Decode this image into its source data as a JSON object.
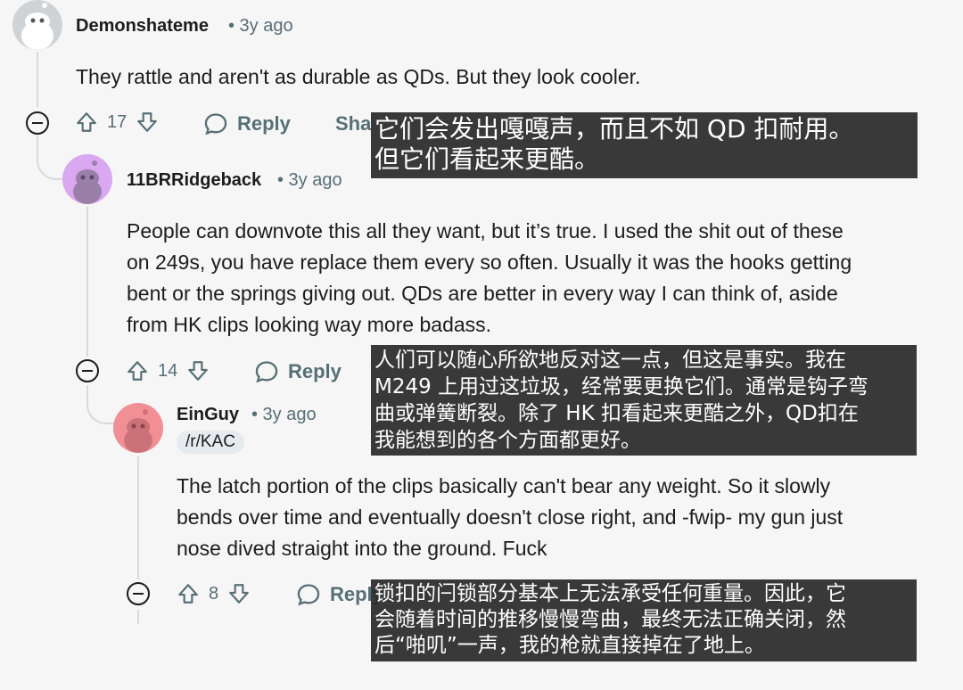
{
  "comments": [
    {
      "username": "Demonshateme",
      "age": "• 3y ago",
      "text": "They rattle and aren't as durable as QDs. But they look cooler.",
      "score": "17",
      "reply_label": "Reply",
      "share_label": "Share"
    },
    {
      "username": "11BRRidgeback",
      "age": "• 3y ago",
      "lines": [
        "People can downvote this all they want, but it’s true. I used the shit out of these",
        "on 249s, you have replace them every so often. Usually it was the hooks getting",
        "bent or the springs giving out. QDs are better in every way I can think of, aside",
        "from HK clips looking way more badass."
      ],
      "score": "14",
      "reply_label": "Reply"
    },
    {
      "username": "EinGuy",
      "age": "• 3y ago",
      "flair": "/r/KAC",
      "lines": [
        "The latch portion of the clips basically can't bear any weight. So it slowly",
        "bends over time and eventually doesn't close right, and -fwip- my gun just",
        "nose dived straight into the ground. Fuck"
      ],
      "score": "8",
      "reply_label": "Reply"
    }
  ],
  "translations": [
    [
      "它们会发出嘎嘎声，而且不如 QD 扣耐用。",
      "但它们看起来更酷。"
    ],
    [
      "人们可以随心所欲地反对这一点，但这是事实。我在",
      "M249 上用过这垃圾，经常要更换它们。通常是钩子弯",
      "曲或弹簧断裂。除了 HK 扣看起来更酷之外，QD扣在",
      "我能想到的各个方面都更好。"
    ],
    [
      "锁扣的闩锁部分基本上无法承受任何重量。因此，它",
      "会随着时间的推移慢慢弯曲，最终无法正确关闭，然",
      "后“啪叽”一声，我的枪就直接掉在了地上。"
    ]
  ],
  "colors": {
    "background": "#f6f6f6",
    "avatar1": "#cfd3d6",
    "avatar2": "#d9a8f0",
    "avatar3": "#f28f95",
    "overlay": "#2a2a2a"
  }
}
